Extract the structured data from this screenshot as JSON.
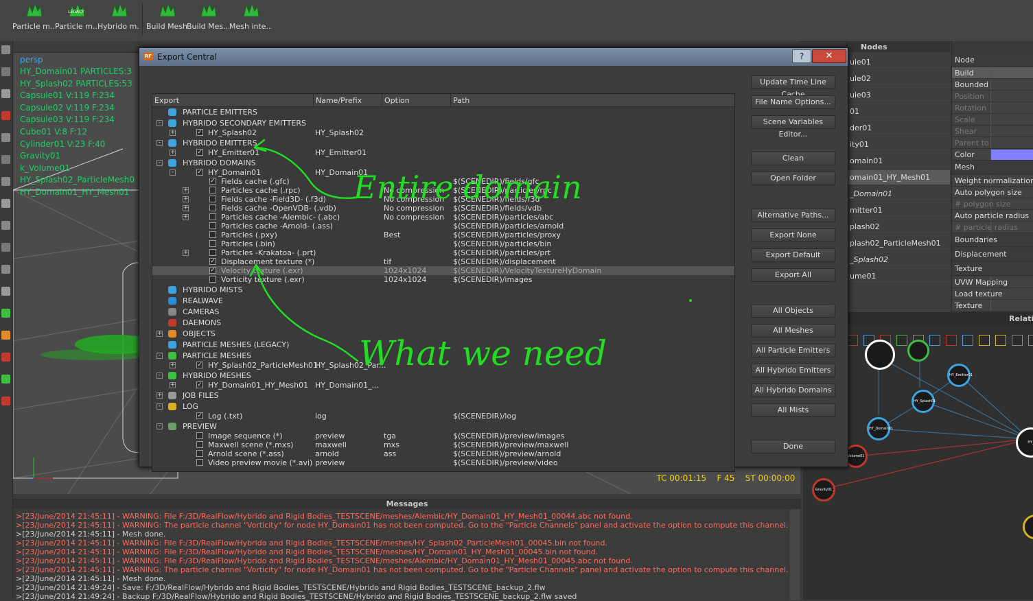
{
  "toolbar": {
    "tools": [
      {
        "label": "Particle m...",
        "icon": "particle-mesh-icon"
      },
      {
        "label": "Particle m...",
        "icon": "particle-mesh-legacy-icon",
        "badge": "LEGACY"
      },
      {
        "label": "Hybrido m...",
        "icon": "hybrido-mesh-icon"
      },
      {
        "label": "Build Mesh",
        "icon": "build-mesh-icon"
      },
      {
        "label": "Build Mes...",
        "icon": "build-mesh-all-icon"
      },
      {
        "label": "Mesh inte...",
        "icon": "mesh-interpolation-icon"
      }
    ]
  },
  "viewport": {
    "camera": "persp",
    "objects": [
      "HY_Domain01 PARTICLES:3",
      "HY_Splash02 PARTICLES:53",
      "Capsule01 V:119 F:234",
      "Capsule02 V:119 F:234",
      "Capsule03 V:119 F:234",
      "Cube01 V:8 F:12",
      "Cylinder01 V:23 F:40",
      "Gravity01",
      "k_Volume01",
      "HY_Splash02_ParticleMesh0",
      "HY_Domain01_HY_Mesh01"
    ],
    "timecode": "TC 00:01:15",
    "frame": "F 45",
    "st": "ST 00:00:00"
  },
  "nodes_panel": {
    "title": "Nodes",
    "items": [
      "ule01",
      "ule02",
      "ule03",
      "01",
      "der01",
      "ity01",
      "omain01",
      "omain01_HY_Mesh01",
      "_Domain01",
      "mitter01",
      "plash02",
      "plash02_ParticleMesh01",
      "_Splash02",
      "ume01"
    ]
  },
  "properties_panel": {
    "header": "Node",
    "rows": [
      {
        "label": "Build",
        "type": "row"
      },
      {
        "label": "Bounded",
        "type": "row"
      },
      {
        "label": "Position",
        "type": "dim"
      },
      {
        "label": "Rotation",
        "type": "dim"
      },
      {
        "label": "Scale",
        "type": "dim"
      },
      {
        "label": "Shear",
        "type": "dim"
      },
      {
        "label": "Parent to",
        "type": "dim"
      },
      {
        "label": "Color",
        "type": "row"
      },
      {
        "label": "Mesh",
        "type": "sec"
      },
      {
        "label": "Weight normalization",
        "type": "row"
      },
      {
        "label": "Auto polygon size",
        "type": "row"
      },
      {
        "label": "# polygon size",
        "type": "dim"
      },
      {
        "label": "Auto particle radius",
        "type": "row"
      },
      {
        "label": "# particle radius",
        "type": "dim"
      },
      {
        "label": "Boundaries",
        "type": "sec"
      },
      {
        "label": "Displacement",
        "type": "sec"
      },
      {
        "label": "Texture",
        "type": "sec"
      },
      {
        "label": "UVW Mapping",
        "type": "row"
      },
      {
        "label": "Load texture",
        "type": "row"
      },
      {
        "label": "Texture",
        "type": "row"
      }
    ],
    "color_swatch": "#8080ff"
  },
  "relationship_panel": {
    "title": "Relati",
    "nodes": [
      "HY_Emitter01",
      "HY_Splash01",
      "HY_Domain01",
      "Volume01",
      "Gravity01",
      "HY_"
    ]
  },
  "dialog": {
    "title": "Export Central",
    "help_label": "?",
    "close_label": "✕",
    "columns": [
      "Export",
      "Name/Prefix",
      "Option",
      "Path"
    ],
    "rows": [
      {
        "indent": 0,
        "exp": "",
        "chk": null,
        "icon": "#3fa3e0",
        "label": "PARTICLE EMITTERS",
        "name": "",
        "option": "",
        "path": ""
      },
      {
        "indent": 0,
        "exp": "-",
        "chk": null,
        "icon": "#3fa3e0",
        "label": "HYBRIDO SECONDARY EMITTERS",
        "name": "",
        "option": "",
        "path": ""
      },
      {
        "indent": 1,
        "exp": "+",
        "chk": true,
        "icon": "",
        "label": "HY_Splash02",
        "name": "HY_Splash02",
        "option": "",
        "path": ""
      },
      {
        "indent": 0,
        "exp": "-",
        "chk": null,
        "icon": "#3fa3e0",
        "label": "HYBRIDO EMITTERS",
        "name": "",
        "option": "",
        "path": ""
      },
      {
        "indent": 1,
        "exp": "+",
        "chk": true,
        "icon": "",
        "label": "HY_Emitter01",
        "name": "HY_Emitter01",
        "option": "",
        "path": ""
      },
      {
        "indent": 0,
        "exp": "-",
        "chk": null,
        "icon": "#3fa3e0",
        "label": "HYBRIDO DOMAINS",
        "name": "",
        "option": "",
        "path": ""
      },
      {
        "indent": 1,
        "exp": "-",
        "chk": true,
        "icon": "",
        "label": "HY_Domain01",
        "name": "HY_Domain01",
        "option": "",
        "path": ""
      },
      {
        "indent": 2,
        "exp": "",
        "chk": true,
        "icon": "",
        "label": "Fields cache (.gfc)",
        "name": "",
        "option": "",
        "path": "$(SCENEDIR)/fields/gfc"
      },
      {
        "indent": 2,
        "exp": "+",
        "chk": false,
        "icon": "",
        "label": "Particles cache (.rpc)",
        "name": "",
        "option": "No compression",
        "path": "$(SCENEDIR)/particles/rpc"
      },
      {
        "indent": 2,
        "exp": "+",
        "chk": false,
        "icon": "",
        "label": "Fields cache -Field3D- (.f3d)",
        "name": "",
        "option": "No compression",
        "path": "$(SCENEDIR)/fields/f3d"
      },
      {
        "indent": 2,
        "exp": "+",
        "chk": false,
        "icon": "",
        "label": "Fields cache -OpenVDB- (.vdb)",
        "name": "",
        "option": "No compression",
        "path": "$(SCENEDIR)/fields/vdb"
      },
      {
        "indent": 2,
        "exp": "+",
        "chk": false,
        "icon": "",
        "label": "Particles cache -Alembic- (.abc)",
        "name": "",
        "option": "No compression",
        "path": "$(SCENEDIR)/particles/abc"
      },
      {
        "indent": 2,
        "exp": "",
        "chk": false,
        "icon": "",
        "label": "Particles cache -Arnold- (.ass)",
        "name": "",
        "option": "",
        "path": "$(SCENEDIR)/particles/arnold"
      },
      {
        "indent": 2,
        "exp": "",
        "chk": false,
        "icon": "",
        "label": "Particles (.pxy)",
        "name": "",
        "option": "Best",
        "path": "$(SCENEDIR)/particles/proxy"
      },
      {
        "indent": 2,
        "exp": "",
        "chk": false,
        "icon": "",
        "label": "Particles (.bin)",
        "name": "",
        "option": "",
        "path": "$(SCENEDIR)/particles/bin"
      },
      {
        "indent": 2,
        "exp": "+",
        "chk": false,
        "icon": "",
        "label": "Particles -Krakatoa- (.prt)",
        "name": "",
        "option": "",
        "path": "$(SCENEDIR)/particles/prt"
      },
      {
        "indent": 2,
        "exp": "",
        "chk": true,
        "icon": "",
        "label": "Displacement texture (*)",
        "name": "",
        "option": "tif",
        "path": "$(SCENEDIR)/displacement"
      },
      {
        "indent": 2,
        "exp": "",
        "chk": true,
        "icon": "",
        "label": "Velocity texture (.exr)",
        "name": "",
        "option": "1024x1024",
        "path": "$(SCENEDIR)/VelocityTextureHyDomain",
        "highlight": true
      },
      {
        "indent": 2,
        "exp": "",
        "chk": false,
        "icon": "",
        "label": "Vorticity texture (.exr)",
        "name": "",
        "option": "1024x1024",
        "path": "$(SCENEDIR)/images"
      },
      {
        "indent": 0,
        "exp": "",
        "chk": null,
        "icon": "#3fa3e0",
        "label": "HYBRIDO MISTS",
        "name": "",
        "option": "",
        "path": ""
      },
      {
        "indent": 0,
        "exp": "",
        "chk": null,
        "icon": "#2b8cd8",
        "label": "REALWAVE",
        "name": "",
        "option": "",
        "path": ""
      },
      {
        "indent": 0,
        "exp": "",
        "chk": null,
        "icon": "#888888",
        "label": "CAMERAS",
        "name": "",
        "option": "",
        "path": ""
      },
      {
        "indent": 0,
        "exp": "",
        "chk": null,
        "icon": "#c0392b",
        "label": "DAEMONS",
        "name": "",
        "option": "",
        "path": ""
      },
      {
        "indent": 0,
        "exp": "+",
        "chk": null,
        "icon": "#e08a2a",
        "label": "OBJECTS",
        "name": "",
        "option": "",
        "path": ""
      },
      {
        "indent": 0,
        "exp": "",
        "chk": null,
        "icon": "#3fa3e0",
        "label": "PARTICLE MESHES (LEGACY)",
        "name": "",
        "option": "",
        "path": ""
      },
      {
        "indent": 0,
        "exp": "-",
        "chk": null,
        "icon": "#3fbf3f",
        "label": "PARTICLE MESHES",
        "name": "",
        "option": "",
        "path": ""
      },
      {
        "indent": 1,
        "exp": "+",
        "chk": true,
        "icon": "",
        "label": "HY_Splash02_ParticleMesh01",
        "name": "HY_Splash02_Par...",
        "option": "",
        "path": ""
      },
      {
        "indent": 0,
        "exp": "-",
        "chk": null,
        "icon": "#3fbf3f",
        "label": "HYBRIDO MESHES",
        "name": "",
        "option": "",
        "path": ""
      },
      {
        "indent": 1,
        "exp": "+",
        "chk": true,
        "icon": "",
        "label": "HY_Domain01_HY_Mesh01",
        "name": "HY_Domain01_...",
        "option": "",
        "path": ""
      },
      {
        "indent": 0,
        "exp": "+",
        "chk": null,
        "icon": "#999999",
        "label": "JOB FILES",
        "name": "",
        "option": "",
        "path": ""
      },
      {
        "indent": 0,
        "exp": "-",
        "chk": null,
        "icon": "#d8b020",
        "label": "LOG",
        "name": "",
        "option": "",
        "path": ""
      },
      {
        "indent": 1,
        "exp": "",
        "chk": true,
        "icon": "",
        "label": "Log (.txt)",
        "name": "log",
        "option": "",
        "path": "$(SCENEDIR)/log"
      },
      {
        "indent": 0,
        "exp": "-",
        "chk": null,
        "icon": "#6aa06a",
        "label": "PREVIEW",
        "name": "",
        "option": "",
        "path": ""
      },
      {
        "indent": 1,
        "exp": "",
        "chk": false,
        "icon": "",
        "label": "Image sequence (*)",
        "name": "preview",
        "option": "tga",
        "path": "$(SCENEDIR)/preview/images"
      },
      {
        "indent": 1,
        "exp": "",
        "chk": false,
        "icon": "",
        "label": "Maxwell scene (*.mxs)",
        "name": "maxwell",
        "option": "mxs",
        "path": "$(SCENEDIR)/preview/maxwell"
      },
      {
        "indent": 1,
        "exp": "",
        "chk": false,
        "icon": "",
        "label": "Arnold scene (*.ass)",
        "name": "arnold",
        "option": "ass",
        "path": "$(SCENEDIR)/preview/arnold"
      },
      {
        "indent": 1,
        "exp": "",
        "chk": false,
        "icon": "",
        "label": "Video preview movie (*.avi)",
        "name": "preview",
        "option": "",
        "path": "$(SCENEDIR)/preview/video"
      }
    ],
    "buttons_group1": [
      "Update Time Line Cache",
      "File Name Options...",
      "Scene Variables Editor..."
    ],
    "buttons_group2": [
      "Clean",
      "Open Folder"
    ],
    "buttons_group3": [
      "Alternative Paths...",
      "Export None",
      "Export Default",
      "Export All"
    ],
    "buttons_group4": [
      "All Objects",
      "All Meshes",
      "All Particle Emitters",
      "All Hybrido Emitters",
      "All Hybrido Domains",
      "All Mists"
    ],
    "done_label": "Done"
  },
  "annotations": {
    "top": "Entire domain",
    "bottom": "What we need",
    "color": "#22dd22"
  },
  "messages": {
    "title": "Messages",
    "lines": [
      {
        "text": ">[23/June/2014 21:45:11] - WARNING: File F:/3D/RealFlow/Hybrido and Rigid Bodies_TESTSCENE/meshes/Alembic/HY_Domain01_HY_Mesh01_00044.abc not found.",
        "type": "warn"
      },
      {
        "text": ">[23/June/2014 21:45:11] - WARNING: The particle channel \"Vorticity\" for node HY_Domain01 has not been computed. Go to the \"Particle Channels\" panel and activate the option to compute this channel.",
        "type": "warn"
      },
      {
        "text": ">[23/June/2014 21:45:11] - Mesh done.",
        "type": "info"
      },
      {
        "text": ">[23/June/2014 21:45:11] - WARNING: File F:/3D/RealFlow/Hybrido and Rigid Bodies_TESTSCENE/meshes/HY_Splash02_ParticleMesh01_00045.bin not found.",
        "type": "warn"
      },
      {
        "text": ">[23/June/2014 21:45:11] - WARNING: File F:/3D/RealFlow/Hybrido and Rigid Bodies_TESTSCENE/meshes/HY_Domain01_HY_Mesh01_00045.bin not found.",
        "type": "warn"
      },
      {
        "text": ">[23/June/2014 21:45:11] - WARNING: File F:/3D/RealFlow/Hybrido and Rigid Bodies_TESTSCENE/meshes/Alembic/HY_Domain01_HY_Mesh01_00045.abc not found.",
        "type": "warn"
      },
      {
        "text": ">[23/June/2014 21:45:11] - WARNING: The particle channel \"Vorticity\" for node HY_Domain01 has not been computed. Go to the \"Particle Channels\" panel and activate the option to compute this channel.",
        "type": "warn"
      },
      {
        "text": ">[23/June/2014 21:45:11] - Mesh done.",
        "type": "info"
      },
      {
        "text": ">[23/June/2014 21:49:24] - Save: F:/3D/RealFlow/Hybrido and Rigid Bodies_TESTSCENE/Hybrido and Rigid Bodies_TESTSCENE_backup_2.flw",
        "type": "info"
      },
      {
        "text": ">[23/June/2014 21:49:24] - Backup F:/3D/RealFlow/Hybrido and Rigid Bodies_TESTSCENE/Hybrido and Rigid Bodies_TESTSCENE_backup_2.flw saved",
        "type": "info"
      }
    ],
    "colors": {
      "warn": "#ff6a5a",
      "info": "#cfcfcf"
    }
  }
}
